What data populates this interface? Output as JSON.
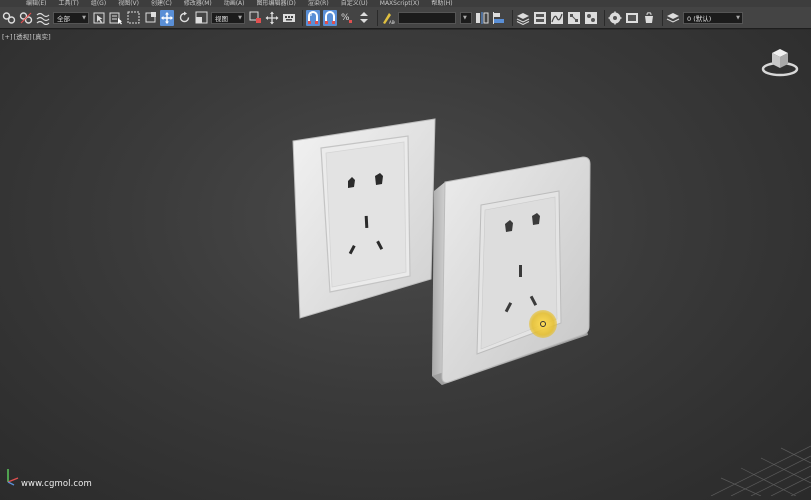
{
  "menu": {
    "items": [
      "编辑(E)",
      "工具(T)",
      "组(G)",
      "视图(V)",
      "创建(C)",
      "修改器(M)",
      "动画(A)",
      "图形编辑器(D)",
      "渲染(R)",
      "自定义(U)",
      "MAXScript(X)",
      "帮助(H)"
    ]
  },
  "toolbar": {
    "selection_filter": "全部",
    "ref_coord_system": "视图",
    "layer_dropdown": "0 (默认)"
  },
  "viewport": {
    "label_plus": "[+]",
    "label_view": "[透视]",
    "label_shading": "[真实]"
  },
  "watermark": "www.cgmol.com",
  "colors": {
    "active_tool": "#5a8fd6",
    "cursor_highlight": "#e8c434",
    "viewport_bg": "#3a3a3a"
  },
  "icons": [
    "link-icon",
    "unlink-icon",
    "bind-space-warp-icon",
    "select-object-icon",
    "select-by-name-icon",
    "rectangle-selection-icon",
    "window-crossing-icon",
    "select-move-icon",
    "select-rotate-icon",
    "select-scale-icon",
    "use-pivot-icon",
    "select-manipulate-icon",
    "keyboard-shortcut-icon",
    "snap-toggle-icon",
    "angle-snap-icon",
    "percent-snap-icon",
    "spinner-snap-icon",
    "edit-named-sets-icon",
    "mirror-icon",
    "align-icon",
    "layer-explorer-icon",
    "graphite-ribbon-icon",
    "curve-editor-icon",
    "schematic-view-icon",
    "material-editor-icon",
    "render-setup-icon",
    "rendered-frame-icon",
    "render-icon",
    "viewcube-icon",
    "axis-tripod-icon"
  ]
}
